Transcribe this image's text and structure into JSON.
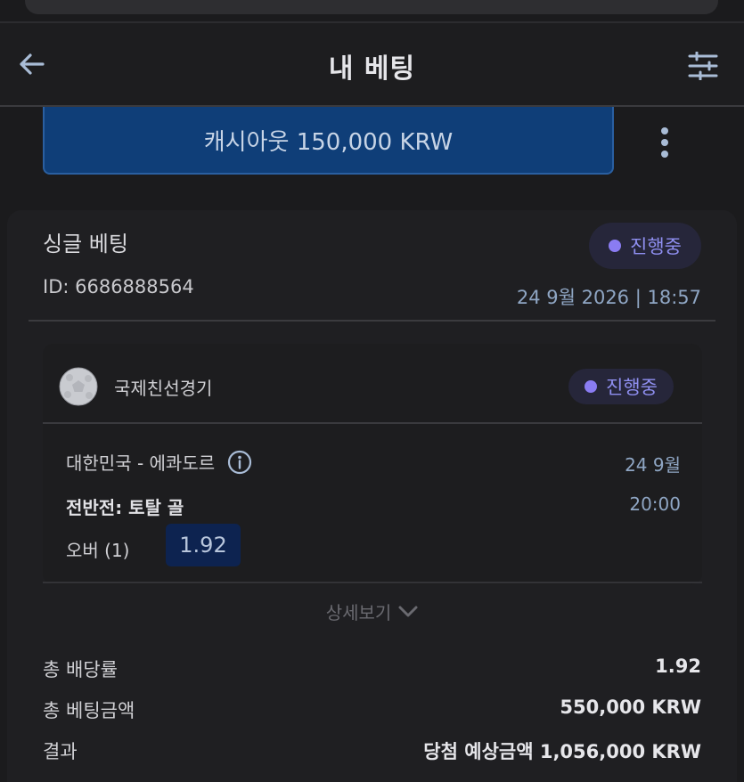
{
  "header": {
    "title": "내 베팅",
    "back_icon": "arrow-left-icon",
    "filter_icon": "sliders-icon"
  },
  "cashout": {
    "label": "캐시아웃 150,000 KRW",
    "more_icon": "more-vertical-icon"
  },
  "bet": {
    "type": "싱글 베팅",
    "id": "ID: 6686888564",
    "status": "진행중",
    "datetime": "24 9월 2026 | 18:57",
    "selection": {
      "league": "국제친선경기",
      "status": "진행중",
      "match": "대한민국 - 에콰도르",
      "match_date": "24 9월",
      "market": "전반전: 토탈 골",
      "match_time": "20:00",
      "pick": "오버 (1)",
      "odds": "1.92"
    },
    "details_label": "상세보기",
    "summary": {
      "total_odds_label": "총 배당률",
      "total_odds_value": "1.92",
      "total_stake_label": "총 베팅금액",
      "total_stake_value": "550,000 KRW",
      "result_label": "결과",
      "result_value": "당첨 예상금액 1,056,000 KRW"
    }
  },
  "colors": {
    "background": "#1b1b1d",
    "cashout_button": "#0f3e78",
    "status_accent": "#8a7cf2",
    "odds_box": "#0d2350",
    "secondary_text": "#8fa6c4"
  }
}
